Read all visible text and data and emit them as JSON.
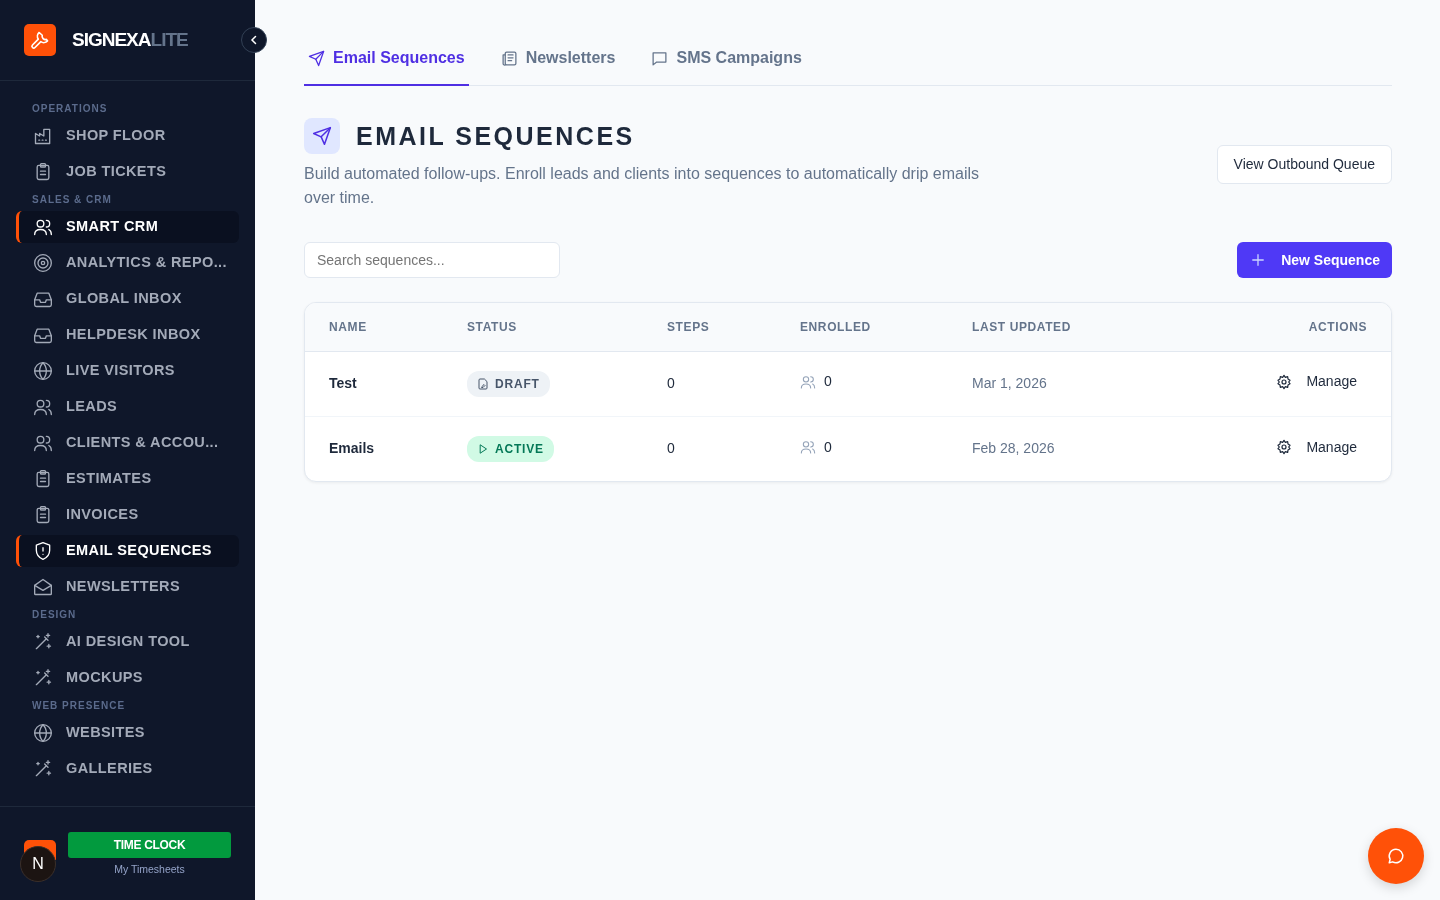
{
  "brand": {
    "name": "SIGNEXA",
    "suffix": "LITE"
  },
  "sidebar": {
    "sections": [
      {
        "title": "OPERATIONS",
        "items": [
          {
            "label": "SHOP FLOOR",
            "kind": "factory",
            "selected": false
          },
          {
            "label": "JOB TICKETS",
            "kind": "clipboard",
            "selected": false
          }
        ]
      },
      {
        "title": "SALES & CRM",
        "items": [
          {
            "label": "SMART CRM",
            "kind": "users",
            "selected": true
          },
          {
            "label": "ANALYTICS & REPO...",
            "kind": "target",
            "selected": false
          },
          {
            "label": "GLOBAL INBOX",
            "kind": "inbox",
            "selected": false
          },
          {
            "label": "HELPDESK INBOX",
            "kind": "inbox",
            "selected": false
          },
          {
            "label": "LIVE VISITORS",
            "kind": "globe",
            "selected": false
          },
          {
            "label": "LEADS",
            "kind": "users",
            "selected": false
          },
          {
            "label": "CLIENTS & ACCOU...",
            "kind": "users",
            "selected": false
          },
          {
            "label": "ESTIMATES",
            "kind": "clipboard",
            "selected": false
          },
          {
            "label": "INVOICES",
            "kind": "clipboard",
            "selected": false
          },
          {
            "label": "EMAIL SEQUENCES",
            "kind": "shield",
            "selected": true
          },
          {
            "label": "NEWSLETTERS",
            "kind": "mail",
            "selected": false
          }
        ]
      },
      {
        "title": "DESIGN",
        "items": [
          {
            "label": "AI DESIGN TOOL",
            "kind": "wand",
            "selected": false
          },
          {
            "label": "MOCKUPS",
            "kind": "wand",
            "selected": false
          }
        ]
      },
      {
        "title": "WEB PRESENCE",
        "items": [
          {
            "label": "WEBSITES",
            "kind": "globe",
            "selected": false
          },
          {
            "label": "GALLERIES",
            "kind": "wand",
            "selected": false
          }
        ]
      }
    ],
    "user_initial": "N",
    "time_clock": "TIME CLOCK",
    "timesheets_link": "My Timesheets"
  },
  "tabs": [
    {
      "label": "Email Sequences",
      "kind": "send",
      "selected": true
    },
    {
      "label": "Newsletters",
      "kind": "newspaper",
      "selected": false
    },
    {
      "label": "SMS Campaigns",
      "kind": "chat",
      "selected": false
    }
  ],
  "header": {
    "title": "EMAIL SEQUENCES",
    "description": "Build automated follow-ups. Enroll leads and clients into sequences to automatically drip emails over time.",
    "queue_button": "View Outbound Queue"
  },
  "search": {
    "placeholder": "Search sequences..."
  },
  "new_button": "New Sequence",
  "table": {
    "columns": [
      "NAME",
      "STATUS",
      "STEPS",
      "ENROLLED",
      "LAST UPDATED",
      "ACTIONS"
    ],
    "rows": [
      {
        "name": "Test",
        "status": "DRAFT",
        "kind": "draft",
        "steps": "0",
        "enrolled": "0",
        "updated": "Mar 1, 2026",
        "action": "Manage"
      },
      {
        "name": "Emails",
        "status": "ACTIVE",
        "kind": "active",
        "steps": "0",
        "enrolled": "0",
        "updated": "Feb 28, 2026",
        "action": "Manage"
      }
    ]
  }
}
